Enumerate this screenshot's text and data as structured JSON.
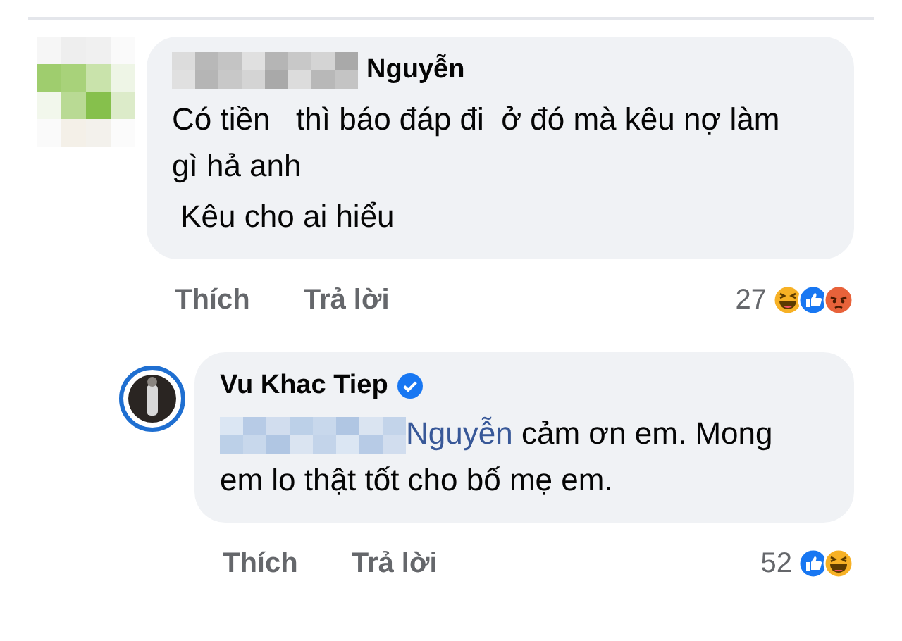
{
  "comments": [
    {
      "author": "Nguyễn",
      "verified": false,
      "paragraphs": [
        "Có tiền   thì báo đáp đi  ở đó mà kêu nợ làm gì hả anh",
        " Kêu cho ai hiểu"
      ],
      "actions": [
        "Thích",
        "Trả lời"
      ],
      "reaction_count": "27",
      "reactions": [
        {
          "kind": "haha"
        },
        {
          "kind": "like"
        },
        {
          "kind": "angry"
        }
      ],
      "replies": [
        {
          "author": "Vu Khac Tiep",
          "verified": true,
          "mention": "Nguyễn",
          "paragraphs": [
            " cảm ơn em. Mong em lo thật tốt cho bố mẹ em."
          ],
          "actions": [
            "Thích",
            "Trả lời"
          ],
          "reaction_count": "52",
          "reactions": [
            {
              "kind": "like"
            },
            {
              "kind": "haha"
            }
          ]
        }
      ]
    }
  ]
}
